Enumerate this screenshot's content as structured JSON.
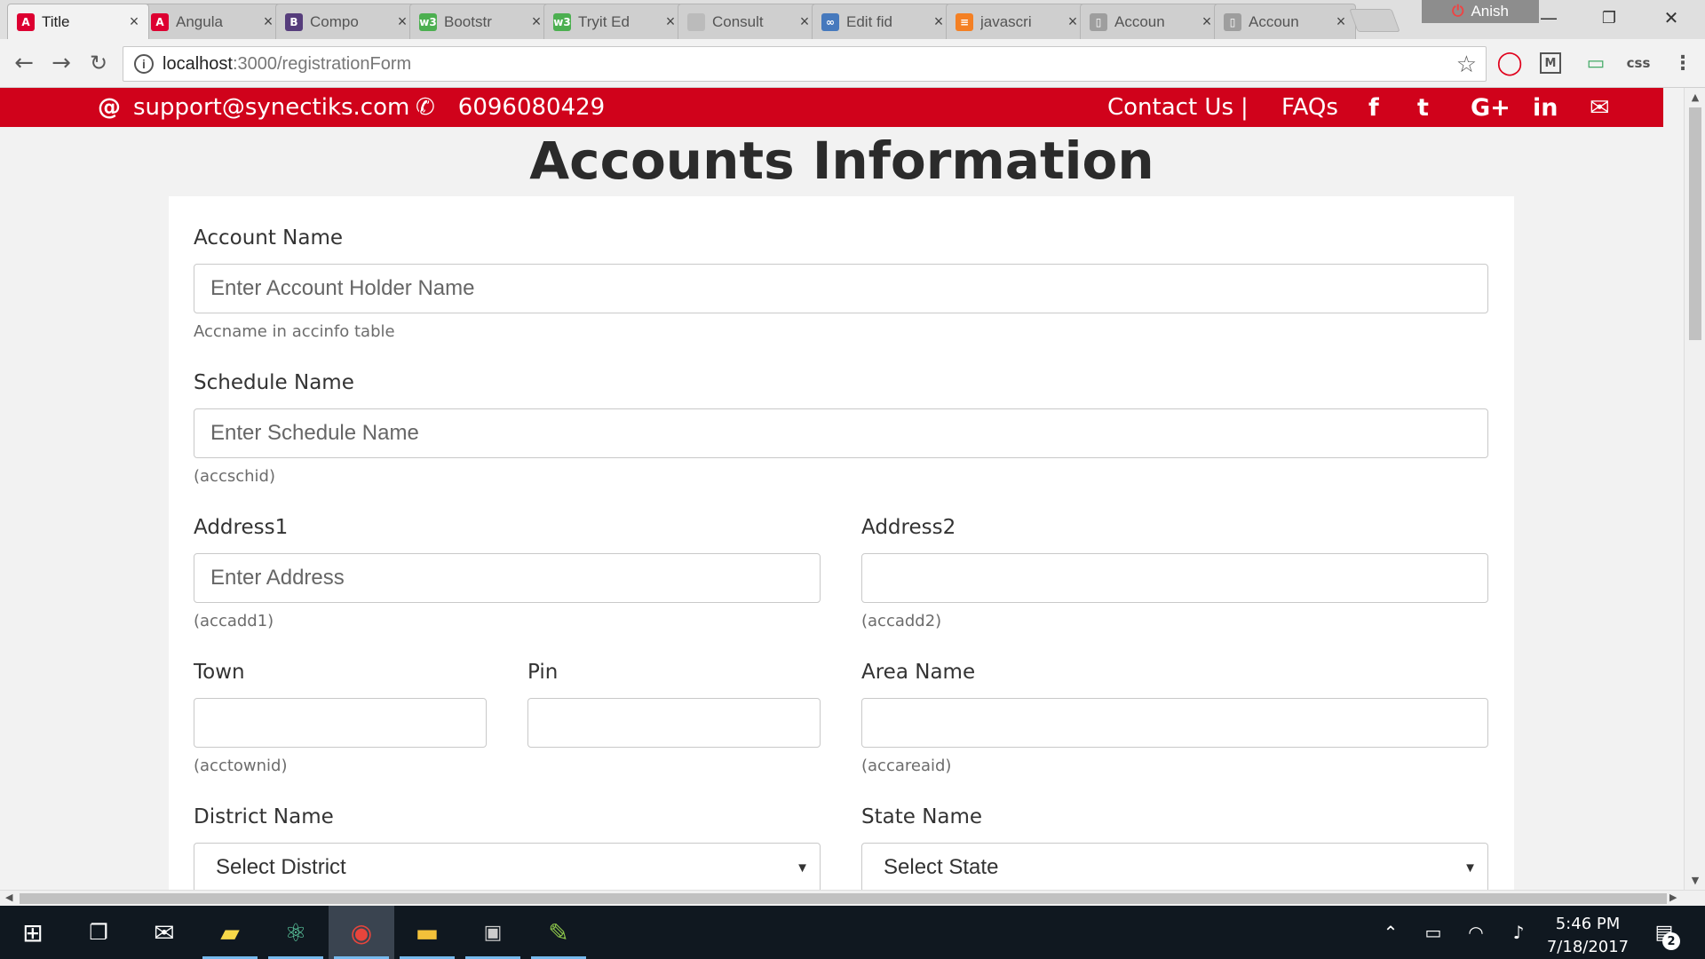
{
  "browser": {
    "tabs": [
      {
        "label": "Title",
        "icon": "angular-icon",
        "color": "#dd0031",
        "glyph": "A",
        "active": true
      },
      {
        "label": "Angula",
        "icon": "angular-icon",
        "color": "#dd0031",
        "glyph": "A",
        "active": false
      },
      {
        "label": "Compo",
        "icon": "bootstrap-icon",
        "color": "#563d7c",
        "glyph": "B",
        "active": false
      },
      {
        "label": "Bootstr",
        "icon": "w3schools-icon",
        "color": "#4caf50",
        "glyph": "w3",
        "active": false
      },
      {
        "label": "Tryit Ed",
        "icon": "w3schools-icon",
        "color": "#4caf50",
        "glyph": "w3",
        "active": false
      },
      {
        "label": "Consult",
        "icon": "page-icon",
        "color": "#bbbbbb",
        "glyph": "",
        "active": false
      },
      {
        "label": "Edit fid",
        "icon": "jsfiddle-icon",
        "color": "#4679bd",
        "glyph": "∞",
        "active": false
      },
      {
        "label": "javascri",
        "icon": "stackoverflow-icon",
        "color": "#f48024",
        "glyph": "≡",
        "active": false
      },
      {
        "label": "Accoun",
        "icon": "document-icon",
        "color": "#9e9e9e",
        "glyph": "▯",
        "active": false
      },
      {
        "label": "Accoun",
        "icon": "document-icon",
        "color": "#9e9e9e",
        "glyph": "▯",
        "active": false
      }
    ],
    "profile_name": "Anish",
    "url_host": "localhost",
    "url_rest": ":3000/registrationForm",
    "extensions": [
      "opera-icon",
      "mercury-icon",
      "monitor-icon",
      "css-icon"
    ],
    "extension_css_label": "css"
  },
  "topbar": {
    "email": "support@synectiks.com",
    "phone": "6096080429",
    "contact_label": "Contact Us",
    "separator": "|",
    "faq_label": "FAQs",
    "social_icons": [
      "facebook-icon",
      "twitter-icon",
      "google-plus-icon",
      "linkedin-icon",
      "email-icon"
    ],
    "social_glyphs": [
      "f",
      "t",
      "G+",
      "in",
      "✉"
    ],
    "bg_color": "#d0021b"
  },
  "form": {
    "title": "Accounts Information",
    "account_name": {
      "label": "Account Name",
      "placeholder": "Enter Account Holder Name",
      "help": "Accname in accinfo table"
    },
    "schedule_name": {
      "label": "Schedule Name",
      "placeholder": "Enter Schedule Name",
      "help": "(accschid)"
    },
    "address1": {
      "label": "Address1",
      "placeholder": "Enter Address",
      "help": "(accadd1)"
    },
    "address2": {
      "label": "Address2",
      "placeholder": "",
      "help": "(accadd2)"
    },
    "town": {
      "label": "Town",
      "placeholder": "",
      "help": "(acctownid)"
    },
    "pin": {
      "label": "Pin",
      "placeholder": ""
    },
    "area_name": {
      "label": "Area Name",
      "placeholder": "",
      "help": "(accareaid)"
    },
    "district_name": {
      "label": "District Name",
      "selected": "Select District"
    },
    "state_name": {
      "label": "State Name",
      "selected": "Select State"
    }
  },
  "taskbar": {
    "apps": [
      "windows-start-icon",
      "task-view-icon",
      "mail-icon",
      "sticky-notes-icon",
      "atom-icon",
      "chrome-icon",
      "file-explorer-icon",
      "terminal-icon",
      "notepad-plus-icon"
    ],
    "time": "5:46 PM",
    "date": "7/18/2017",
    "notification_count": "2"
  }
}
